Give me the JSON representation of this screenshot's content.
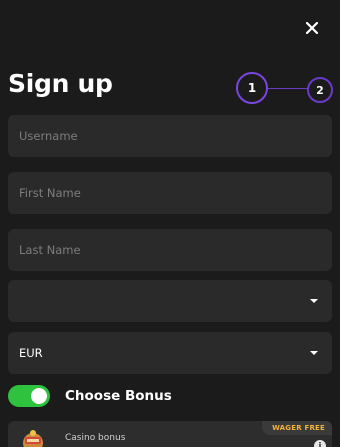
{
  "header": {
    "title": "Sign up"
  },
  "stepper": {
    "current": 1,
    "steps": [
      "1",
      "2"
    ]
  },
  "form": {
    "username": {
      "placeholder": "Username",
      "value": ""
    },
    "first_name": {
      "placeholder": "First Name",
      "value": ""
    },
    "last_name": {
      "placeholder": "Last Name",
      "value": ""
    },
    "country_select": {
      "value": ""
    },
    "currency_select": {
      "value": "EUR"
    }
  },
  "bonus": {
    "toggle_on": true,
    "toggle_label": "Choose Bonus",
    "card": {
      "label": "Casino bonus",
      "badge": "WAGER FREE",
      "info_glyph": "i"
    }
  },
  "icons": {
    "close": "close-icon",
    "caret": "chevron-down-icon",
    "info": "info-icon"
  },
  "colors": {
    "background": "#1b1b1b",
    "field_bg": "#2a2a2a",
    "accent_purple": "#7b46e0",
    "toggle_green": "#2fc23f",
    "badge_text": "#f3b23a"
  }
}
